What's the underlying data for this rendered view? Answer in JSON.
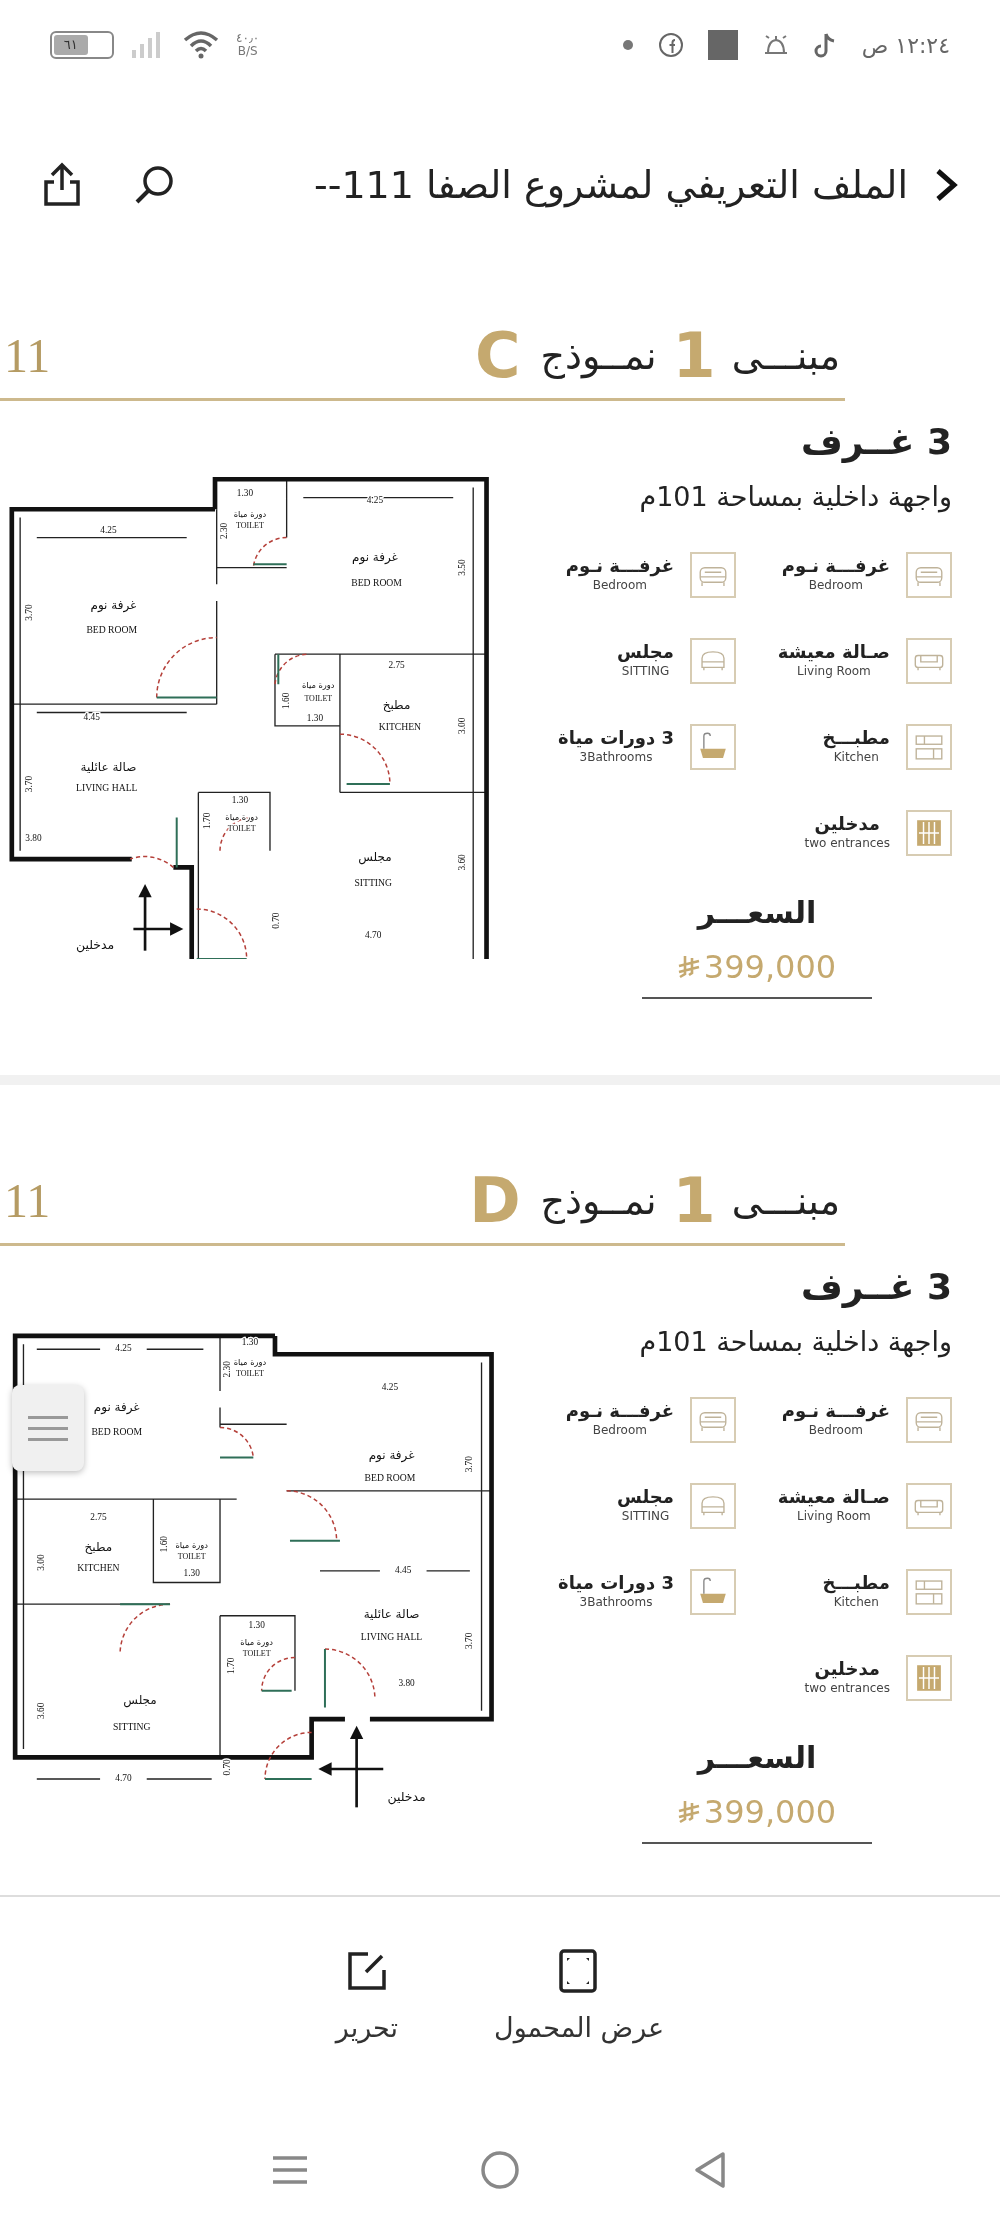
{
  "status_bar": {
    "time": "١٢:٢٤ ص",
    "speed": "٤٠٫٠",
    "speed_unit": "B/S",
    "battery": "٦١"
  },
  "header": {
    "title": "الملف التعريفي لمشروع الصفا 111--"
  },
  "pages": [
    {
      "kind": "plan-a",
      "page_number": "11",
      "building_label": "مبنـــى",
      "building_number": "1",
      "model_label": "نمــوذج",
      "model_letter": "C",
      "rooms": "3 غــرف",
      "facade": "واجهة داخلية بمساحة 101م",
      "features": [
        {
          "ar": "غرفـــة نـوم",
          "en": "Bedroom",
          "kind": "bed"
        },
        {
          "ar": "غرفـــة نـوم",
          "en": "Bedroom",
          "kind": "bed"
        },
        {
          "ar": "صـالة معيشة",
          "en": "Living Room",
          "kind": "sofa"
        },
        {
          "ar": "مجلس",
          "en": "SITTING",
          "kind": "armchair"
        },
        {
          "ar": "مطبـــخ",
          "en": "Kitchen",
          "kind": "kitchen"
        },
        {
          "ar": "3 دورات مياة",
          "en": "3Bathrooms",
          "kind": "bathtub"
        },
        {
          "ar": "مدخلين",
          "en": "two entrances",
          "kind": "door"
        }
      ],
      "price_label": "السعـــر",
      "price": "399,000",
      "plan_labels": [
        {
          "text": "1.30",
          "kind": "dimension"
        },
        {
          "text": "دورة مياة",
          "kind": "toilet"
        },
        {
          "text": "TOILET",
          "kind": "toilet-en"
        },
        {
          "text": "2.30",
          "kind": "dimension"
        },
        {
          "text": "4.25",
          "kind": "dimension"
        },
        {
          "text": "غرفة نوم",
          "kind": "room"
        },
        {
          "text": "BED ROOM",
          "kind": "room-en"
        },
        {
          "text": "3.50",
          "kind": "dimension"
        },
        {
          "text": "4.25",
          "kind": "dimension"
        },
        {
          "text": "3.70",
          "kind": "dimension"
        },
        {
          "text": "غرفة نوم",
          "kind": "room"
        },
        {
          "text": "BED ROOM",
          "kind": "room-en"
        },
        {
          "text": "دورة مياة",
          "kind": "toilet"
        },
        {
          "text": "TOILET",
          "kind": "toilet-en"
        },
        {
          "text": "1.60",
          "kind": "dimension"
        },
        {
          "text": "1.30",
          "kind": "dimension"
        },
        {
          "text": "2.75",
          "kind": "dimension"
        },
        {
          "text": "مطبخ",
          "kind": "room"
        },
        {
          "text": "KITCHEN",
          "kind": "room-en"
        },
        {
          "text": "3.00",
          "kind": "dimension"
        },
        {
          "text": "4.45",
          "kind": "dimension"
        },
        {
          "text": "صالة عائلية",
          "kind": "room"
        },
        {
          "text": "LIVING HALL",
          "kind": "room-en"
        },
        {
          "text": "3.70",
          "kind": "dimension"
        },
        {
          "text": "3.80",
          "kind": "dimension"
        },
        {
          "text": "1.30",
          "kind": "dimension"
        },
        {
          "text": "دورة مياة",
          "kind": "toilet"
        },
        {
          "text": "TOILET",
          "kind": "toilet-en"
        },
        {
          "text": "1.70",
          "kind": "dimension"
        },
        {
          "text": "مجلس",
          "kind": "room"
        },
        {
          "text": "SITTING",
          "kind": "room-en"
        },
        {
          "text": "3.60",
          "kind": "dimension"
        },
        {
          "text": "0.70",
          "kind": "dimension"
        },
        {
          "text": "4.70",
          "kind": "dimension"
        },
        {
          "text": "مدخلين",
          "kind": "entrance"
        }
      ]
    },
    {
      "kind": "plan-b",
      "page_number": "11",
      "building_label": "مبنـــى",
      "building_number": "1",
      "model_label": "نمــوذج",
      "model_letter": "D",
      "rooms": "3 غــرف",
      "facade": "واجهة داخلية بمساحة 101م",
      "features": [
        {
          "ar": "غرفـــة نـوم",
          "en": "Bedroom",
          "kind": "bed"
        },
        {
          "ar": "غرفـــة نـوم",
          "en": "Bedroom",
          "kind": "bed"
        },
        {
          "ar": "صـالة معيشة",
          "en": "Living Room",
          "kind": "sofa"
        },
        {
          "ar": "مجلس",
          "en": "SITTING",
          "kind": "armchair"
        },
        {
          "ar": "مطبـــخ",
          "en": "Kitchen",
          "kind": "kitchen"
        },
        {
          "ar": "3 دورات مياة",
          "en": "3Bathrooms",
          "kind": "bathtub"
        },
        {
          "ar": "مدخلين",
          "en": "two entrances",
          "kind": "door"
        }
      ],
      "price_label": "السعـــر",
      "price": "399,000",
      "plan_labels": [
        {
          "text": "4.25",
          "kind": "dimension"
        },
        {
          "text": "غرفة نوم",
          "kind": "room"
        },
        {
          "text": "BED ROOM",
          "kind": "room-en"
        },
        {
          "text": "1.30",
          "kind": "dimension"
        },
        {
          "text": "دورة مياة",
          "kind": "toilet"
        },
        {
          "text": "TOILET",
          "kind": "toilet-en"
        },
        {
          "text": "2.30",
          "kind": "dimension"
        },
        {
          "text": "4.25",
          "kind": "dimension"
        },
        {
          "text": "غرفة نوم",
          "kind": "room"
        },
        {
          "text": "BED ROOM",
          "kind": "room-en"
        },
        {
          "text": "3.70",
          "kind": "dimension"
        },
        {
          "text": "2.75",
          "kind": "dimension"
        },
        {
          "text": "مطبخ",
          "kind": "room"
        },
        {
          "text": "KITCHEN",
          "kind": "room-en"
        },
        {
          "text": "3.00",
          "kind": "dimension"
        },
        {
          "text": "1.60",
          "kind": "dimension"
        },
        {
          "text": "دورة مياة",
          "kind": "toilet"
        },
        {
          "text": "TOILET",
          "kind": "toilet-en"
        },
        {
          "text": "1.30",
          "kind": "dimension"
        },
        {
          "text": "4.45",
          "kind": "dimension"
        },
        {
          "text": "صالة عائلية",
          "kind": "room"
        },
        {
          "text": "LIVING HALL",
          "kind": "room-en"
        },
        {
          "text": "3.70",
          "kind": "dimension"
        },
        {
          "text": "3.80",
          "kind": "dimension"
        },
        {
          "text": "1.30",
          "kind": "dimension"
        },
        {
          "text": "دورة مياة",
          "kind": "toilet"
        },
        {
          "text": "TOILET",
          "kind": "toilet-en"
        },
        {
          "text": "1.70",
          "kind": "dimension"
        },
        {
          "text": "مجلس",
          "kind": "room"
        },
        {
          "text": "SITTING",
          "kind": "room-en"
        },
        {
          "text": "3.60",
          "kind": "dimension"
        },
        {
          "text": "0.70",
          "kind": "dimension"
        },
        {
          "text": "4.70",
          "kind": "dimension"
        },
        {
          "text": "مدخلين",
          "kind": "entrance"
        }
      ]
    }
  ],
  "actions": [
    {
      "label": "عرض المحمول",
      "kind": "mobile-view"
    },
    {
      "label": "تحرير",
      "kind": "edit"
    }
  ]
}
